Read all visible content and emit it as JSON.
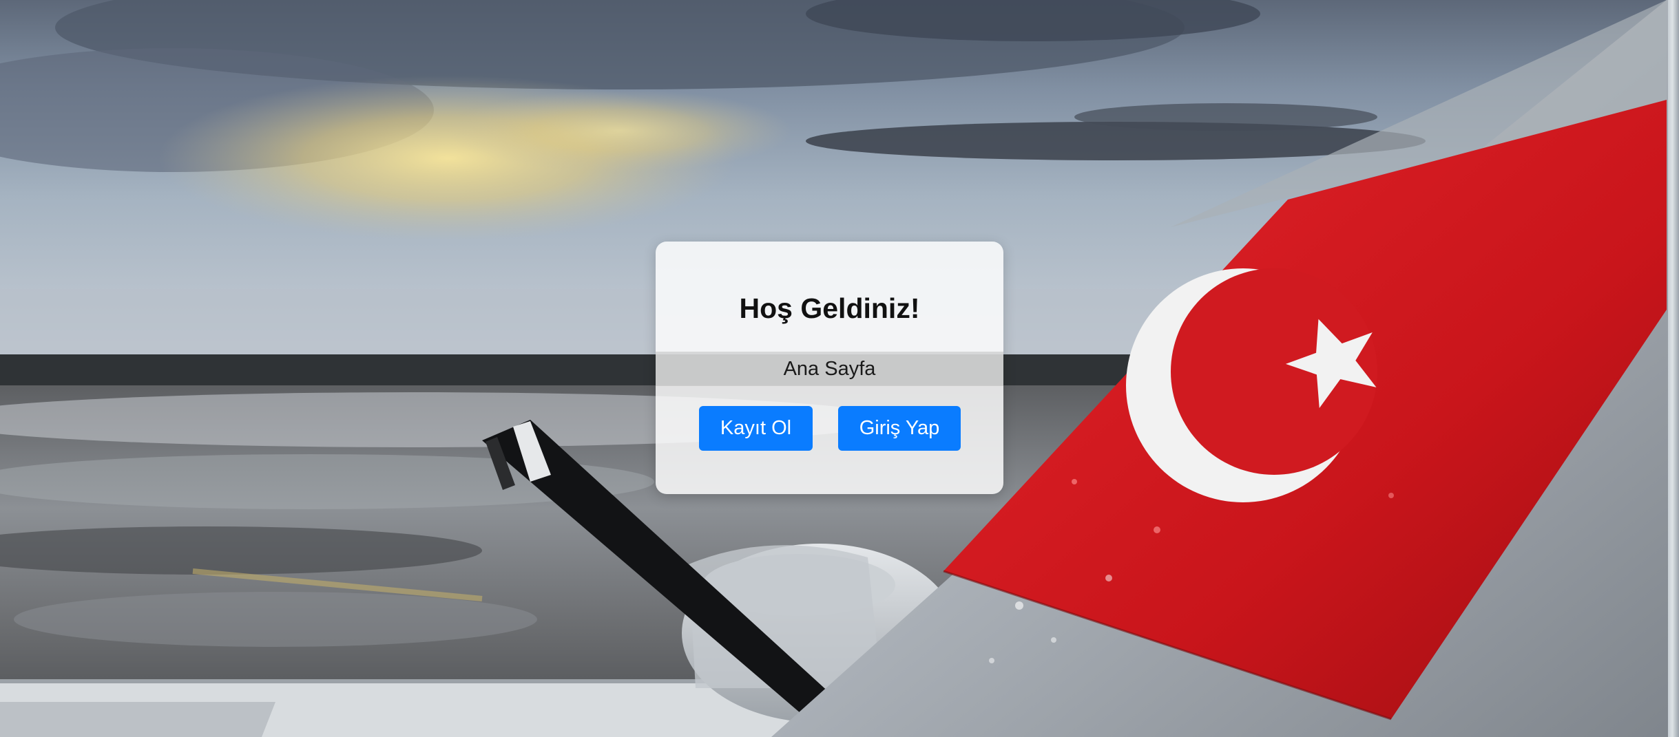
{
  "welcome": {
    "title": "Hoş Geldiniz!",
    "subtitle": "Ana Sayfa",
    "register_label": "Kayıt Ol",
    "login_label": "Giriş Yap"
  },
  "colors": {
    "button": "#0a7cff",
    "flag_red": "#d8161c"
  },
  "background": {
    "icon": "turkish-flag-aircraft-tail-photo"
  }
}
